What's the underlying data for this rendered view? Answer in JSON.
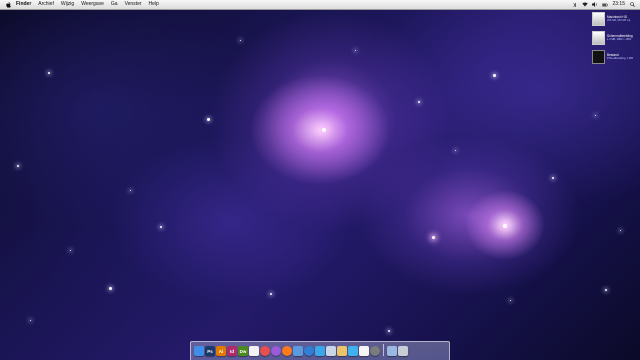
{
  "menubar": {
    "app_name": "Finder",
    "menus": [
      "Archief",
      "Wijzig",
      "Weergave",
      "Ga",
      "Venster",
      "Help"
    ],
    "clock": "23:15",
    "status_icons": [
      "bluetooth-icon",
      "wifi-icon",
      "volume-icon",
      "battery-icon",
      "spotlight-icon"
    ]
  },
  "desktop_items": [
    {
      "name": "Macintosh HD",
      "meta": "250 GB, 183 GB vrij",
      "icon": "hard-drive-icon"
    },
    {
      "name": "Schermafbeelding",
      "meta": "1.3 MB, 2880 × 1800",
      "icon": "screenshot-file-icon"
    },
    {
      "name": "Bestand",
      "meta": "PNG-afbeelding, 1 MB",
      "icon": "image-file-icon"
    }
  ],
  "dock": {
    "apps": [
      {
        "name": "Finder",
        "icon": "finder-icon",
        "color": "#3f8ee8",
        "glyph": ""
      },
      {
        "name": "Photoshop",
        "icon": "photoshop-icon",
        "color": "#1b3a6b",
        "glyph": "Ps"
      },
      {
        "name": "Illustrator",
        "icon": "illustrator-icon",
        "color": "#e07b00",
        "glyph": "Ai"
      },
      {
        "name": "InDesign",
        "icon": "indesign-icon",
        "color": "#b02a6c",
        "glyph": "Id"
      },
      {
        "name": "Dreamweaver",
        "icon": "dreamweaver-icon",
        "color": "#4a8a1e",
        "glyph": "Dw"
      },
      {
        "name": "Pages",
        "icon": "pages-icon",
        "color": "#f2f2f2",
        "glyph": ""
      },
      {
        "name": "Photos",
        "icon": "photos-icon",
        "color": "#e84f4f",
        "glyph": ""
      },
      {
        "name": "iTunes",
        "icon": "itunes-icon",
        "color": "#9b5bd6",
        "glyph": ""
      },
      {
        "name": "Firefox",
        "icon": "firefox-icon",
        "color": "#ff7a1a",
        "glyph": ""
      },
      {
        "name": "Mail",
        "icon": "mail-icon",
        "color": "#5a9ae0",
        "glyph": ""
      },
      {
        "name": "Safari",
        "icon": "safari-icon",
        "color": "#2f7fd6",
        "glyph": ""
      },
      {
        "name": "Twitter",
        "icon": "twitter-icon",
        "color": "#3aa7e8",
        "glyph": ""
      },
      {
        "name": "Preview",
        "icon": "preview-icon",
        "color": "#c9d6ea",
        "glyph": ""
      },
      {
        "name": "Notes",
        "icon": "notes-icon",
        "color": "#e9c46a",
        "glyph": ""
      },
      {
        "name": "Messages",
        "icon": "messages-icon",
        "color": "#3fb0f0",
        "glyph": ""
      },
      {
        "name": "Calendar",
        "icon": "calendar-icon",
        "color": "#f5f5f5",
        "glyph": ""
      },
      {
        "name": "System Preferences",
        "icon": "system-preferences-icon",
        "color": "#7c7c7c",
        "glyph": ""
      }
    ],
    "stacks": [
      {
        "name": "Documents",
        "icon": "documents-folder-icon",
        "color": "#9bb9e0"
      },
      {
        "name": "Trash",
        "icon": "trash-icon",
        "color": "#c8ccd4"
      }
    ]
  }
}
